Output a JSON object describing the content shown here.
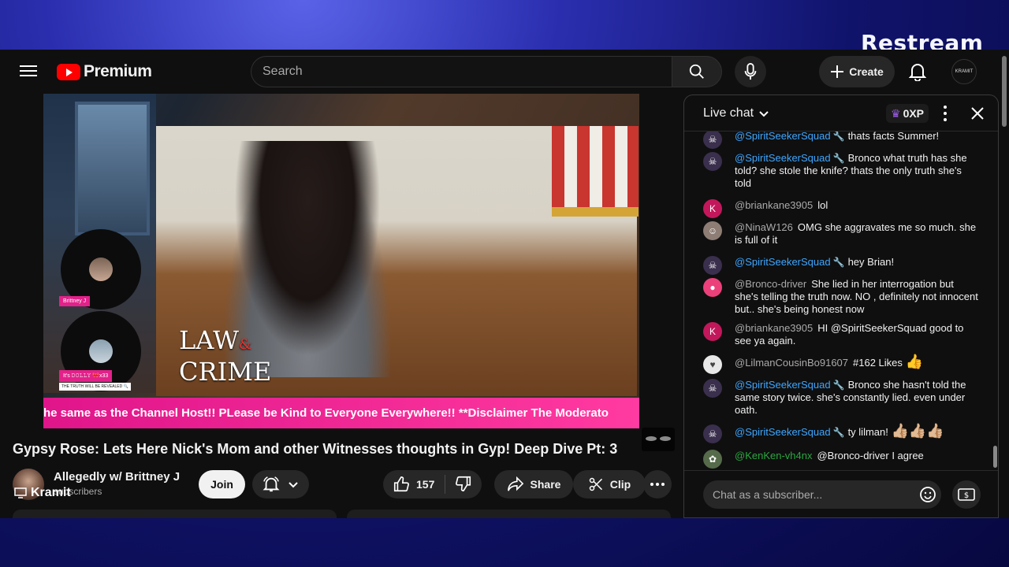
{
  "overlay": {
    "brand": "Restream"
  },
  "masthead": {
    "logo_text": "Premium",
    "search_placeholder": "Search",
    "create_label": "Create",
    "account_initial": "KRAMIT"
  },
  "video": {
    "watermark_line1": "LAW",
    "watermark_amp": "&",
    "watermark_line2": "CRIME",
    "guest1_name": "Brittney J",
    "guest2_name": "It's 𝙳𝙾𝙻𝙻𝚈 🎀x33",
    "guest2_sub": "THE TRUTH WILL BE REVEALED 🔍",
    "ticker_text": "he same as the Channel Host!! PLease be Kind to Everyone Everywhere!! **Disclaimer The Moderato"
  },
  "meta": {
    "title": "Gypsy Rose: Lets Here Nick's Mom and other Witnesses thoughts in Gyp! Deep Dive Pt: 3",
    "channel_name": "Allegedly w/ Brittney J",
    "subscribers": "subscribers",
    "join_label": "Join",
    "like_count": "157",
    "share_label": "Share",
    "clip_label": "Clip",
    "screen_label": "Kramit"
  },
  "chat": {
    "title": "Live chat",
    "xp": "0XP",
    "input_placeholder": "Chat as a subscriber...",
    "messages": [
      {
        "author": "@SpiritSeekerSquad",
        "text": "thats facts Summer!"
      },
      {
        "author": "@SpiritSeekerSquad",
        "text": "Bronco what truth has she told? she stole the knife? thats the only truth she's told"
      },
      {
        "author": "@briankane3905",
        "text": "lol"
      },
      {
        "author": "@NinaW126",
        "text": "OMG she aggravates me so much. she is full of it"
      },
      {
        "author": "@SpiritSeekerSquad",
        "text": "hey Brian!"
      },
      {
        "author": "@Bronco-driver",
        "text": "She lied in her interrogation but she's telling the truth now. NO , definitely not innocent but.. she's being honest now"
      },
      {
        "author": "@briankane3905",
        "text": "HI @SpiritSeekerSquad good to see ya again."
      },
      {
        "author": "@LilmanCousinBo91607",
        "text": "#162 Likes"
      },
      {
        "author": "@SpiritSeekerSquad",
        "text": "Bronco she hasn't told the same story twice. she's constantly lied. even under oath."
      },
      {
        "author": "@SpiritSeekerSquad",
        "text": "ty lilman!"
      },
      {
        "author": "@KenKen-vh4nx",
        "text": "@Bronco-driver I agree"
      }
    ]
  }
}
